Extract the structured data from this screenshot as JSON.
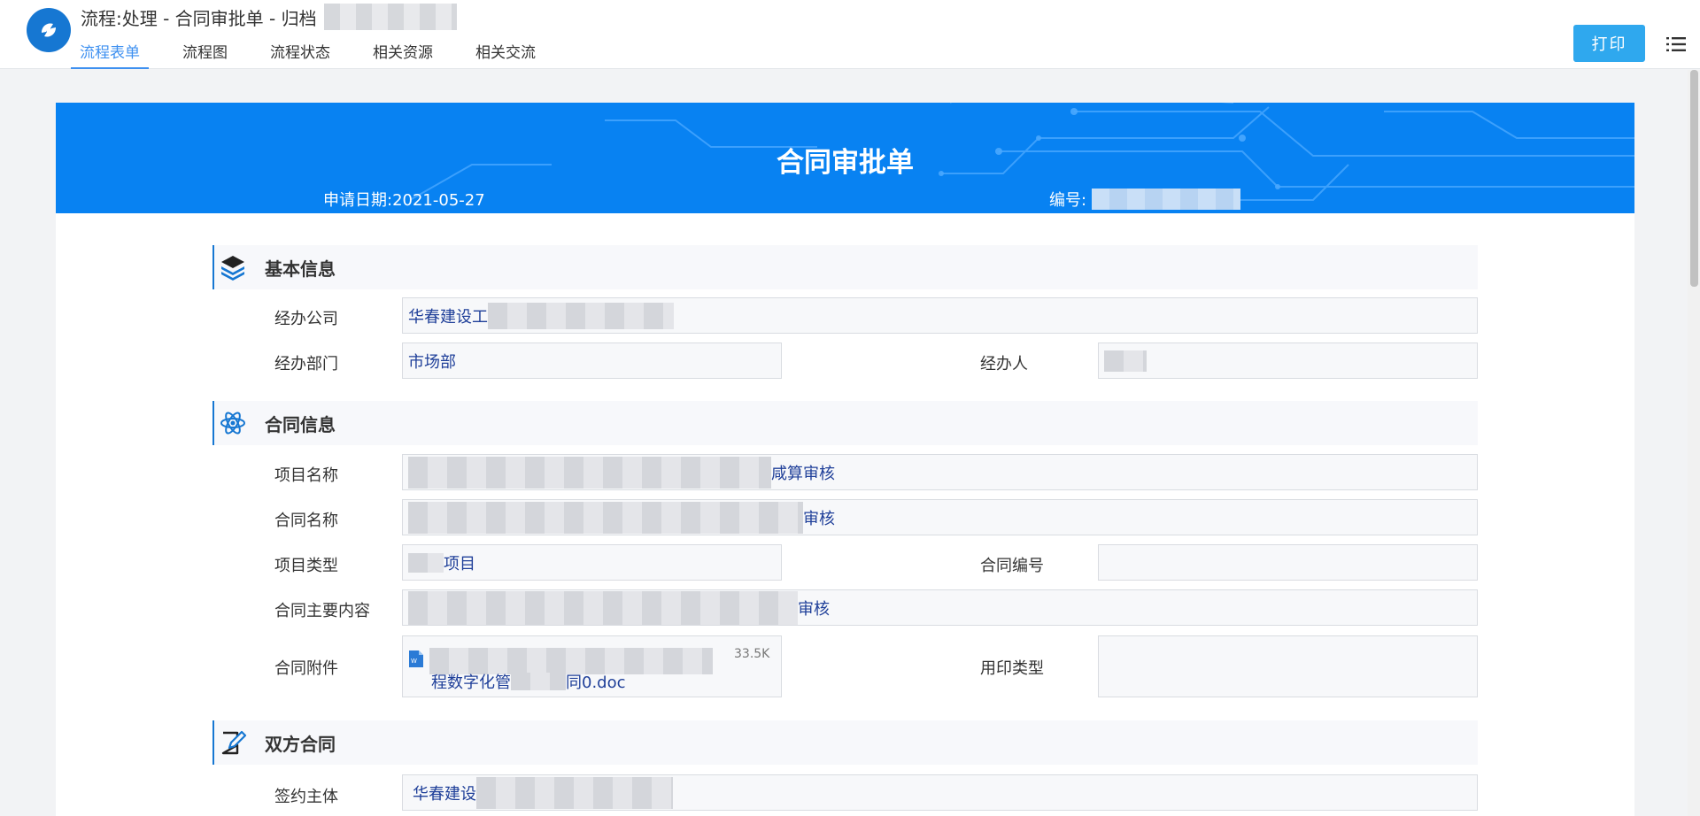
{
  "header": {
    "title": "流程:处理 - 合同审批单 - 归档",
    "tabs": [
      "流程表单",
      "流程图",
      "流程状态",
      "相关资源",
      "相关交流"
    ],
    "active_tab": 0,
    "print_label": "打印"
  },
  "form": {
    "title": "合同审批单",
    "apply_date_label": "申请日期:",
    "apply_date": "2021-05-27",
    "serial_label": "编号:"
  },
  "sections": {
    "basic": {
      "title": "基本信息",
      "company_label": "经办公司",
      "company_value": "华春建设工",
      "dept_label": "经办部门",
      "dept_value": "市场部",
      "handler_label": "经办人"
    },
    "contract": {
      "title": "合同信息",
      "project_name_label": "项目名称",
      "project_name_tail": "咸算审核",
      "contract_name_label": "合同名称",
      "contract_name_tail": "审核",
      "project_type_label": "项目类型",
      "project_type_value": "项目",
      "contract_no_label": "合同编号",
      "main_content_label": "合同主要内容",
      "main_content_tail": "审核",
      "attachment_label": "合同附件",
      "attachment_name": "程数字化管",
      "attachment_name_tail": "同0.doc",
      "attachment_size": "33.5K",
      "seal_type_label": "用印类型"
    },
    "parties": {
      "title": "双方合同",
      "signer_label": "签约主体",
      "signer_value": "华春建设"
    }
  },
  "colors": {
    "brand": "#1677d2",
    "banner": "#0882f2",
    "print_button": "#2fa8ee",
    "active_tab": "#3e90f0"
  },
  "icons": {
    "logo": "app-logo-icon",
    "menu": "list-menu-icon",
    "basic": "layers-icon",
    "contract": "atom-icon",
    "parties": "edit-document-icon",
    "attachment": "word-document-icon"
  }
}
